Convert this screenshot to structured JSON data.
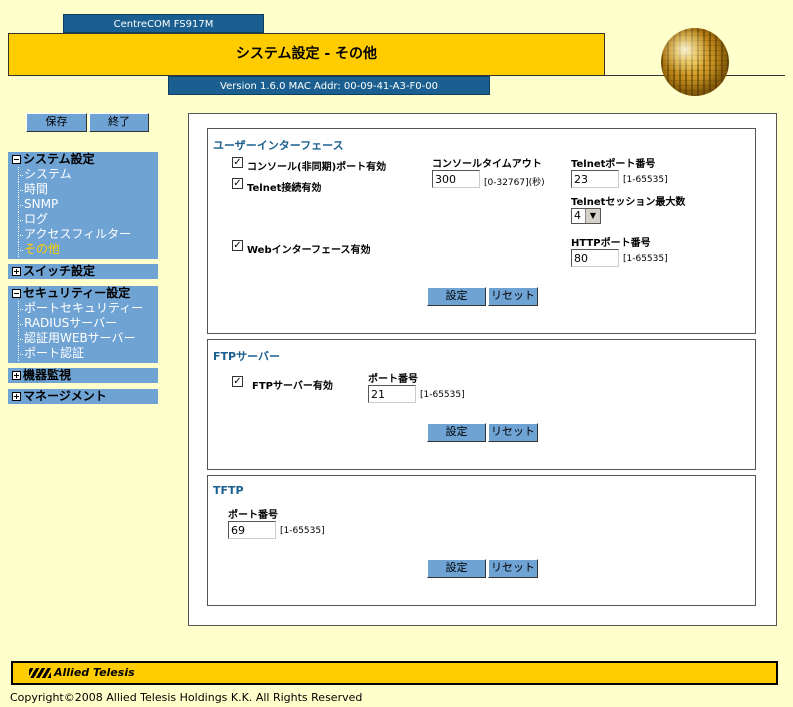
{
  "header": {
    "model": "CentreCOM FS917M",
    "title": "システム設定 - その他",
    "version": "Version 1.6.0 MAC Addr: 00-09-41-A3-F0-00"
  },
  "sidebar": {
    "save_label": "保存",
    "exit_label": "終了",
    "groups": [
      {
        "label": "システム設定",
        "expanded": true,
        "items": [
          "システム",
          "時間",
          "SNMP",
          "ログ",
          "アクセスフィルター",
          "その他"
        ],
        "active": "その他"
      },
      {
        "label": "スイッチ設定",
        "expanded": false
      },
      {
        "label": "セキュリティー設定",
        "expanded": true,
        "items": [
          "ポートセキュリティー",
          "RADIUSサーバー",
          "認証用WEBサーバー",
          "ポート認証"
        ]
      },
      {
        "label": "機器監視",
        "expanded": false
      },
      {
        "label": "マネージメント",
        "expanded": false
      }
    ]
  },
  "ui_section": {
    "title": "ユーザーインターフェース",
    "console_enable_label": "コンソール(非同期)ポート有効",
    "console_enable_checked": true,
    "telnet_enable_label": "Telnet接続有効",
    "telnet_enable_checked": true,
    "web_enable_label": "Webインターフェース有効",
    "web_enable_checked": true,
    "console_timeout_label": "コンソールタイムアウト",
    "console_timeout_value": "300",
    "console_timeout_hint": "[0-32767](秒)",
    "telnet_port_label": "Telnetポート番号",
    "telnet_port_value": "23",
    "telnet_port_hint": "[1-65535]",
    "telnet_sessions_label": "Telnetセッション最大数",
    "telnet_sessions_value": "4",
    "http_port_label": "HTTPポート番号",
    "http_port_value": "80",
    "http_port_hint": "[1-65535]",
    "set_label": "設定",
    "reset_label": "リセット"
  },
  "ftp_section": {
    "title": "FTPサーバー",
    "enable_label": "FTPサーバー有効",
    "enable_checked": true,
    "port_label": "ポート番号",
    "port_value": "21",
    "port_hint": "[1-65535]",
    "set_label": "設定",
    "reset_label": "リセット"
  },
  "tftp_section": {
    "title": "TFTP",
    "port_label": "ポート番号",
    "port_value": "69",
    "port_hint": "[1-65535]",
    "set_label": "設定",
    "reset_label": "リセット"
  },
  "footer": {
    "brand": "Allied Telesis",
    "copyright": "Copyright©2008 Allied Telesis Holdings K.K. All Rights Reserved"
  },
  "colors": {
    "background": "#ffffcc",
    "accent_blue": "#1a5f8f",
    "nav_blue": "#6fa3d4",
    "header_yellow": "#ffcc00",
    "active_item": "#ffcc00"
  }
}
